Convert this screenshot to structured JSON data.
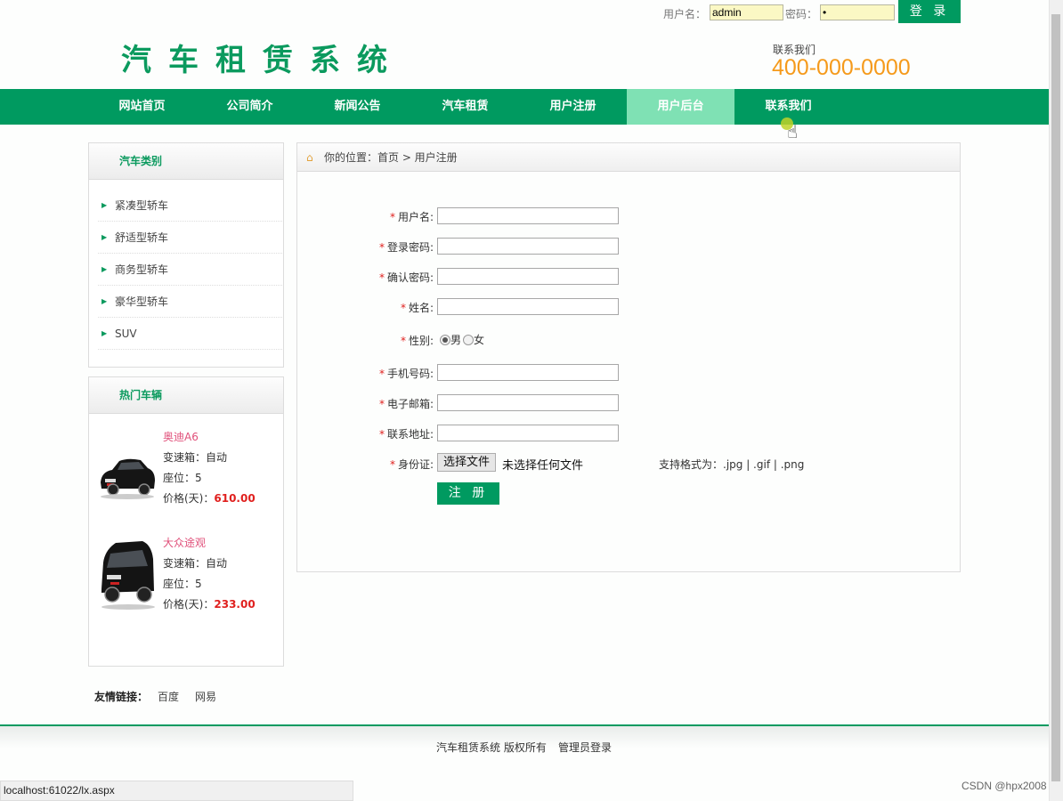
{
  "login": {
    "username_label": "用户名：",
    "username_value": "admin",
    "password_label": "密码：",
    "password_value": "•",
    "submit_label": "登 录"
  },
  "header": {
    "title": "汽车租赁系统",
    "contact_label": "联系我们",
    "contact_phone": "400-000-0000"
  },
  "nav": {
    "items": [
      {
        "label": "网站首页"
      },
      {
        "label": "公司简介"
      },
      {
        "label": "新闻公告"
      },
      {
        "label": "汽车租赁"
      },
      {
        "label": "用户注册"
      },
      {
        "label": "用户后台"
      },
      {
        "label": "联系我们"
      }
    ],
    "active_index": 5
  },
  "sidebar": {
    "categories_title": "汽车类别",
    "categories": [
      {
        "label": "紧凑型轿车"
      },
      {
        "label": "舒适型轿车"
      },
      {
        "label": "商务型轿车"
      },
      {
        "label": "豪华型轿车"
      },
      {
        "label": "SUV"
      }
    ],
    "hot_title": "热门车辆",
    "hot_cars": [
      {
        "name": "奥迪A6",
        "gearbox": "变速箱：自动",
        "seats": "座位：5",
        "price_label": "价格(天)：",
        "price": "610.00"
      },
      {
        "name": "大众途观",
        "gearbox": "变速箱：自动",
        "seats": "座位：5",
        "price_label": "价格(天)：",
        "price": "233.00"
      }
    ]
  },
  "breadcrumb": {
    "text": "你的位置：首页 > 用户注册"
  },
  "form": {
    "required_mark": "*",
    "username_label": "用户名:",
    "password_label": "登录密码:",
    "confirm_label": "确认密码:",
    "name_label": "姓名:",
    "gender_label": "性别:",
    "gender_male": "男",
    "gender_female": "女",
    "gender_selected": "男",
    "phone_label": "手机号码:",
    "email_label": "电子邮箱:",
    "address_label": "联系地址:",
    "id_label": "身份证:",
    "file_button": "选择文件",
    "file_status": "未选择任何文件",
    "file_hint": "支持格式为：.jpg | .gif | .png",
    "submit_label": "注 册"
  },
  "links": {
    "label": "友情链接：",
    "items": [
      {
        "label": "百度"
      },
      {
        "label": "网易"
      }
    ]
  },
  "footer": {
    "copyright": "汽车租赁系统 版权所有",
    "admin_login": "管理员登录"
  },
  "status": {
    "url": "localhost:61022/lx.aspx",
    "watermark": "CSDN @hpx2008"
  },
  "colors": {
    "brand_green": "#009a60",
    "active_nav": "#7fe1b4",
    "phone_orange": "#f59a1b",
    "price_red": "#e0201e"
  }
}
